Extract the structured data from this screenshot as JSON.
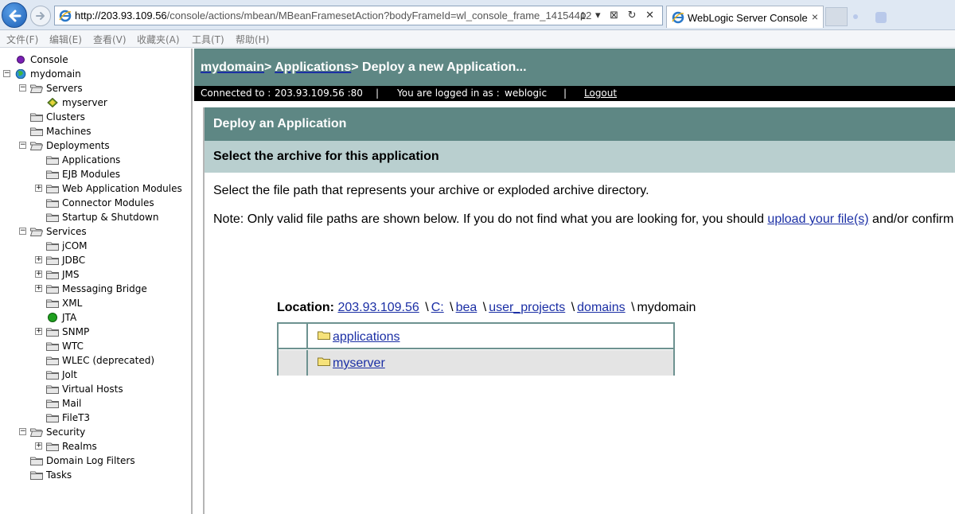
{
  "browser": {
    "url_host": "http://203.93.109.56",
    "url_path": "/console/actions/mbean/MBeanFramesetAction?bodyFrameId=wl_console_frame_141544122",
    "address_tools": "ρ ▾ ⊠ ↻ ✕",
    "tab_title": "WebLogic Server Console",
    "tab_close": "×"
  },
  "menu": [
    "文件(F)",
    "编辑(E)",
    "查看(V)",
    "收藏夹(A)",
    "工具(T)",
    "帮助(H)"
  ],
  "tree": [
    {
      "label": "Console",
      "icon": "purple-dot-icon"
    },
    {
      "label": "mydomain",
      "icon": "globe-icon",
      "toggle": "⊟"
    },
    {
      "label": "Servers",
      "icon": "folder-open-icon",
      "toggle": "⊟"
    },
    {
      "label": "myserver",
      "icon": "server-diamond-icon"
    },
    {
      "label": "Clusters",
      "icon": "folder-icon"
    },
    {
      "label": "Machines",
      "icon": "folder-icon"
    },
    {
      "label": "Deployments",
      "icon": "folder-open-icon",
      "toggle": "⊟"
    },
    {
      "label": "Applications",
      "icon": "folder-icon"
    },
    {
      "label": "EJB Modules",
      "icon": "folder-icon"
    },
    {
      "label": "Web Application Modules",
      "icon": "folder-icon",
      "toggle": "⊞"
    },
    {
      "label": "Connector Modules",
      "icon": "folder-icon"
    },
    {
      "label": "Startup & Shutdown",
      "icon": "folder-icon"
    },
    {
      "label": "Services",
      "icon": "folder-open-icon",
      "toggle": "⊟"
    },
    {
      "label": "jCOM",
      "icon": "folder-icon"
    },
    {
      "label": "JDBC",
      "icon": "folder-icon",
      "toggle": "⊞"
    },
    {
      "label": "JMS",
      "icon": "folder-icon",
      "toggle": "⊞"
    },
    {
      "label": "Messaging Bridge",
      "icon": "folder-icon",
      "toggle": "⊞"
    },
    {
      "label": "XML",
      "icon": "folder-icon"
    },
    {
      "label": "JTA",
      "icon": "green-dot-icon"
    },
    {
      "label": "SNMP",
      "icon": "folder-icon",
      "toggle": "⊞"
    },
    {
      "label": "WTC",
      "icon": "folder-icon"
    },
    {
      "label": "WLEC (deprecated)",
      "icon": "folder-icon"
    },
    {
      "label": "Jolt",
      "icon": "folder-icon"
    },
    {
      "label": "Virtual Hosts",
      "icon": "folder-icon"
    },
    {
      "label": "Mail",
      "icon": "folder-icon"
    },
    {
      "label": "FileT3",
      "icon": "folder-icon"
    },
    {
      "label": "Security",
      "icon": "folder-open-icon",
      "toggle": "⊟"
    },
    {
      "label": "Realms",
      "icon": "folder-icon",
      "toggle": "⊞"
    },
    {
      "label": "Domain Log Filters",
      "icon": "folder-icon"
    },
    {
      "label": "Tasks",
      "icon": "folder-icon"
    }
  ],
  "header": {
    "crumb_domain": "mydomain",
    "crumb_sep1": ">",
    "crumb_apps": "Applications",
    "crumb_rest": "> Deploy a new Application..."
  },
  "status": {
    "connected_label": "Connected to :",
    "connected_value": "203.93.109.56 :80",
    "divider": "|",
    "logged_label": "You are logged in as :",
    "logged_value": "weblogic",
    "logout": "Logout"
  },
  "panel": {
    "title": "Deploy an Application",
    "subtitle": "Select the archive for this application",
    "intro": "Select the file path that represents your archive or exploded archive directory.",
    "note_before": "Note: Only valid file paths are shown below. If you do not find what you are looking for, you should ",
    "note_link": "upload your file(s)",
    "note_after": " and/or confirm your a"
  },
  "location": {
    "label": "Location:",
    "parts": [
      "203.93.109.56",
      "C:",
      "bea",
      "user_projects",
      "domains"
    ],
    "separator": "\\",
    "current": "mydomain"
  },
  "files": [
    {
      "name": "applications",
      "icon": "folder-icon"
    },
    {
      "name": "myserver",
      "icon": "folder-icon"
    }
  ],
  "colors": {
    "header_teal": "#5e8784",
    "subheader": "#b9cfcf",
    "link": "#1b2fa5",
    "row_alt": "#e4e4e4"
  }
}
